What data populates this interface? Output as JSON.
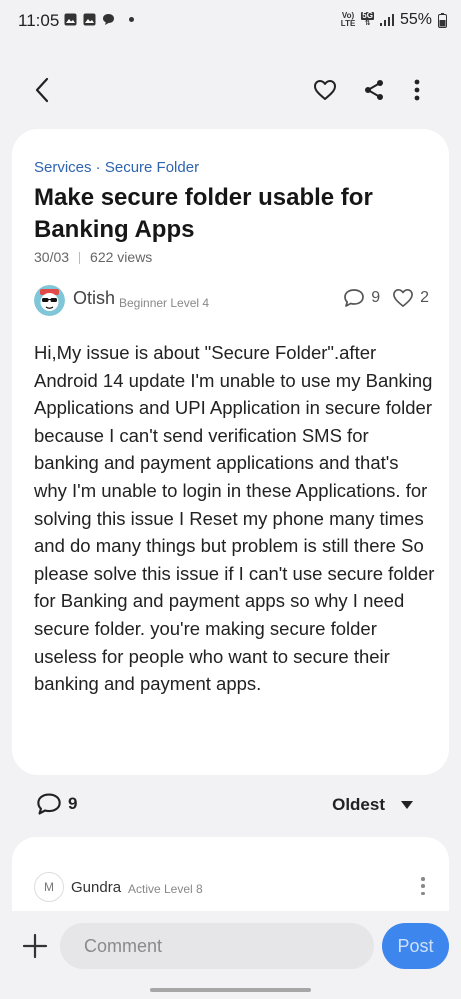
{
  "status_bar": {
    "time": "11:05",
    "network_top": "Vo)",
    "network_bottom": "LTE",
    "gen_label": "5G",
    "battery_percent": "55%"
  },
  "nav": {
    "back_icon": "chevron-left-icon",
    "like_icon": "heart-icon",
    "share_icon": "share-icon",
    "more_icon": "kebab-icon"
  },
  "post": {
    "breadcrumb": "Services · Secure Folder",
    "title": "Make secure folder usable for Banking Apps",
    "date": "30/03",
    "views": "622 views",
    "author": {
      "name": "Otish",
      "level": "Beginner Level 4"
    },
    "comment_count": "9",
    "like_count": "2",
    "body": "Hi,My issue is about  \"Secure Folder\".after Android 14 update I'm unable to use my Banking Applications and UPI Application in secure folder because I can't send verification SMS for banking and payment applications and that's why I'm unable to login in these Applications. for solving this issue I Reset my phone many times and do many things but problem is still there So please solve this issue if I can't use secure folder for Banking and payment apps so why I need secure folder. you're making secure folder useless for people who want to secure their banking and payment apps."
  },
  "comments": {
    "count": "9",
    "sort_label": "Oldest",
    "first": {
      "name": "Gundra",
      "level": "Active Level 8",
      "avatar_initial": "M"
    }
  },
  "composer": {
    "placeholder": "Comment",
    "post_label": "Post"
  },
  "colors": {
    "accent": "#3d86ee",
    "link": "#2f64b0",
    "background": "#f2f2f4"
  }
}
